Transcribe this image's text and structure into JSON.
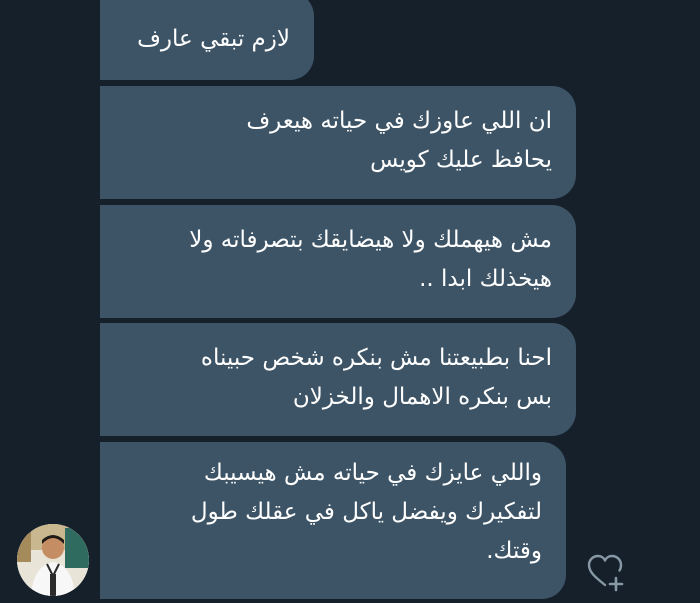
{
  "conversation": {
    "messages": [
      {
        "text": "لازم تبقي عارف"
      },
      {
        "text": "ان اللي عاوزك  في حياته هيعرف\nيحافظ عليك كويس"
      },
      {
        "text": "مش هيهملك ولا هيضايقك بتصرفاته ولا\nهيخذلك ابدا .."
      },
      {
        "text": "احنا بطبيعتنا مش بنكره شخص حبيناه\nبس بنكره الاهمال والخزلان"
      },
      {
        "text": "واللي عايزك في حياته مش هيسيبك\nلتفكيرك ويفضل ياكل في عقلك طول\nوقتك."
      }
    ]
  },
  "icons": {
    "like": "heart-plus-icon",
    "avatar": "profile-photo"
  },
  "colors": {
    "background": "#15202b",
    "bubble": "#3d5466",
    "text": "#ffffff",
    "icon": "#8899a6"
  }
}
